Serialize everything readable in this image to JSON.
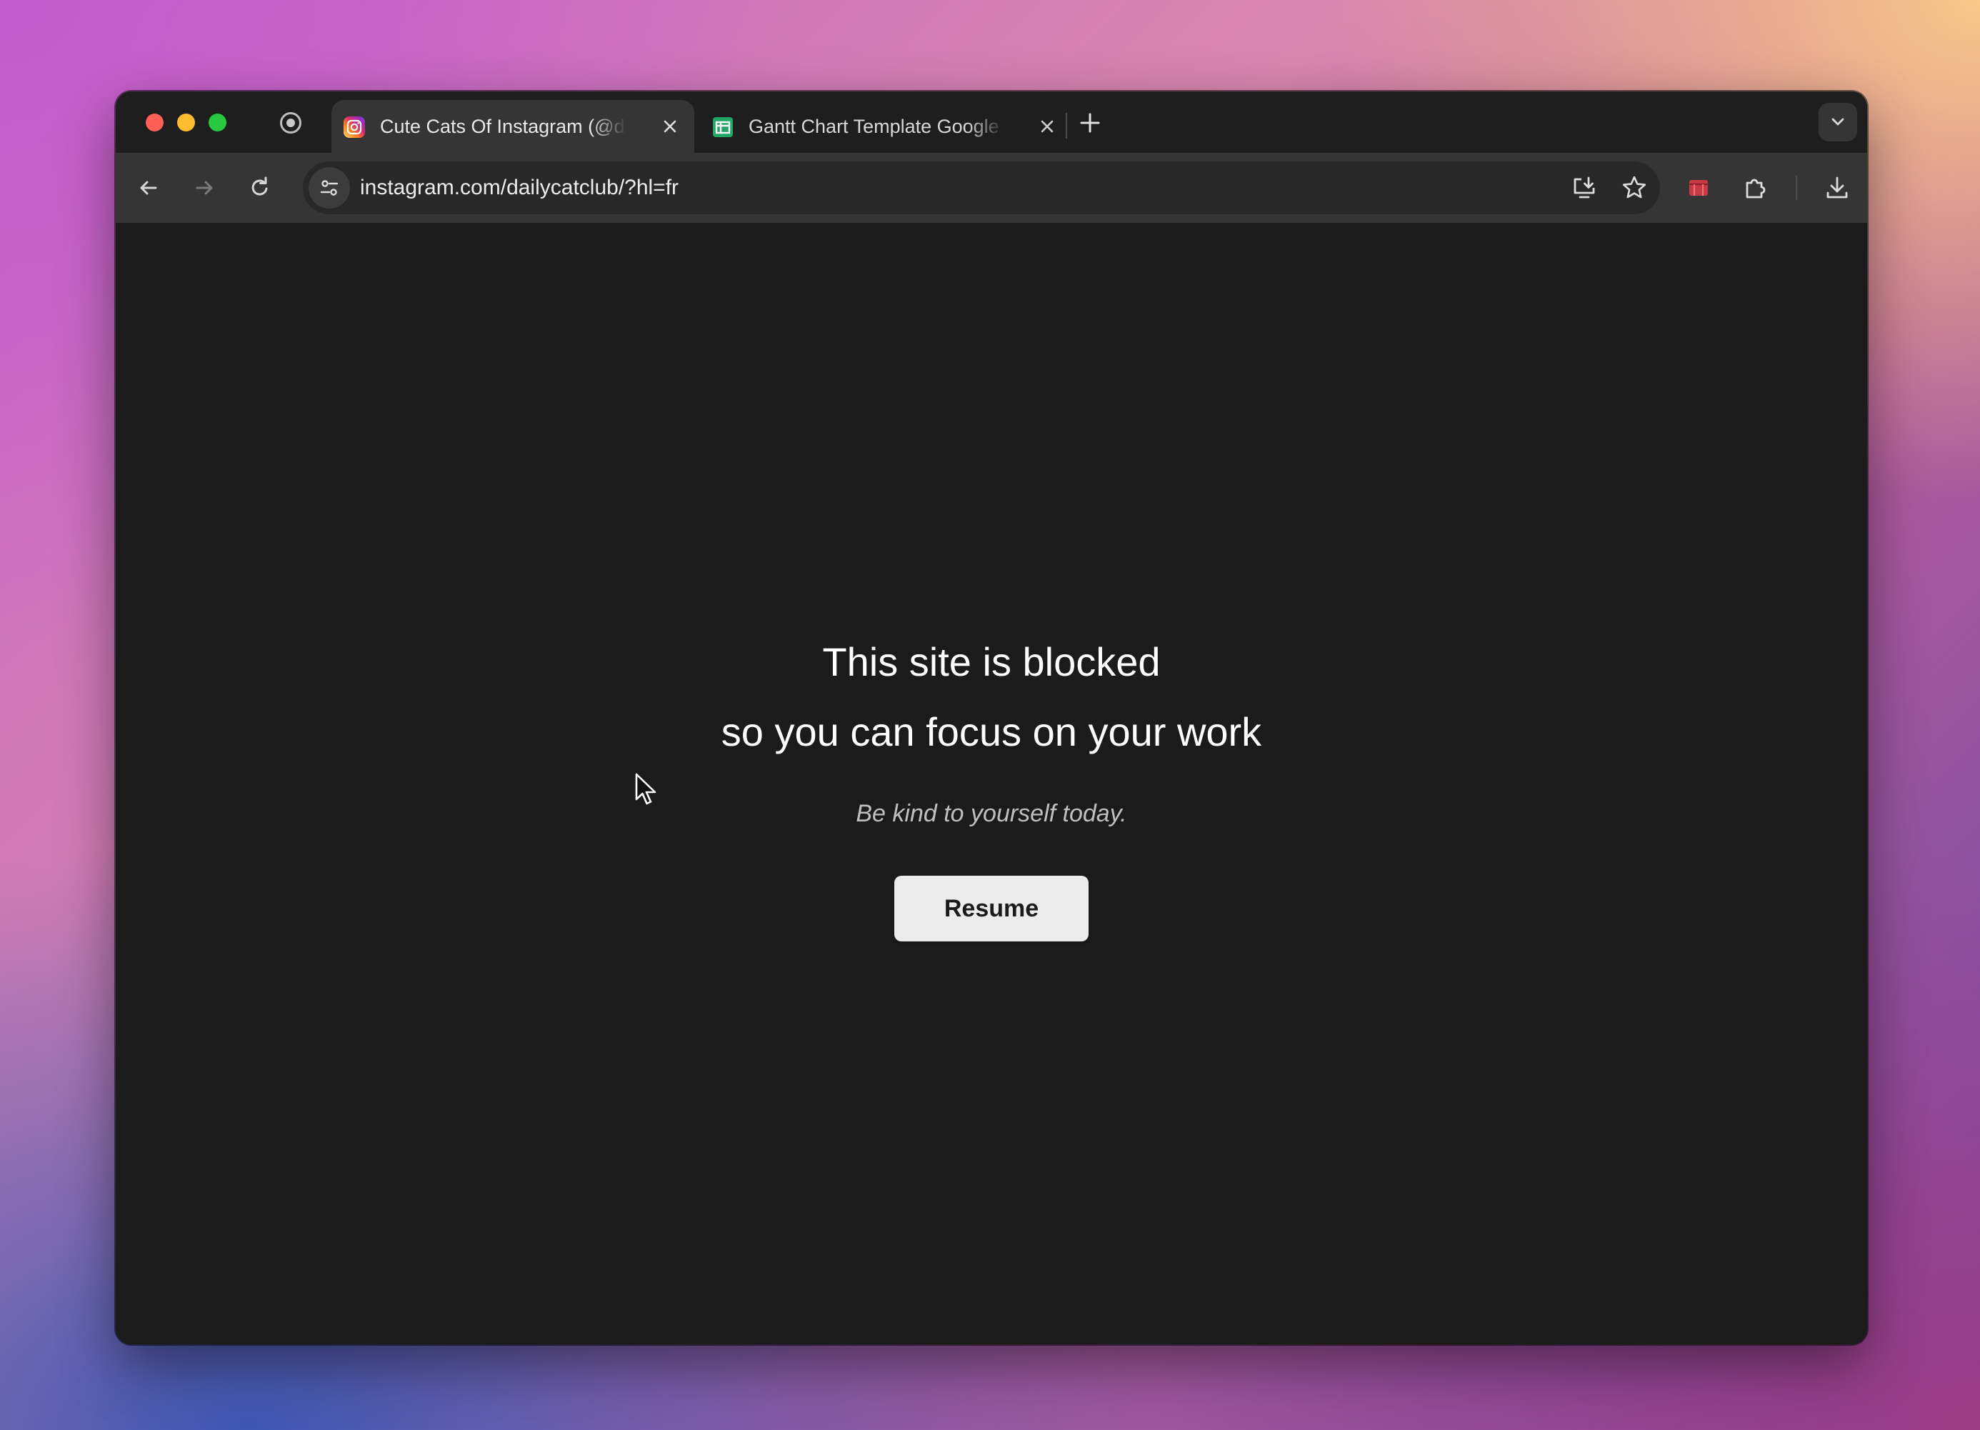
{
  "browser": {
    "tabs": [
      {
        "title": "Cute Cats Of Instagram (@dailycatclub)",
        "favicon": "instagram-icon",
        "active": true
      },
      {
        "title": "Gantt Chart Template Google Sheets",
        "favicon": "google-sheets-icon",
        "active": false
      }
    ],
    "address_bar": {
      "url": "instagram.com/dailycatclub/?hl=fr"
    }
  },
  "page": {
    "heading_line1": "This site is blocked",
    "heading_line2": "so you can focus on your work",
    "tagline": "Be kind to yourself today.",
    "resume_label": "Resume"
  },
  "colors": {
    "page_background": "#1b1b1b",
    "button_background": "#ececec",
    "traffic_red": "#fe5f57",
    "traffic_yellow": "#febc2e",
    "traffic_green": "#28c840"
  }
}
